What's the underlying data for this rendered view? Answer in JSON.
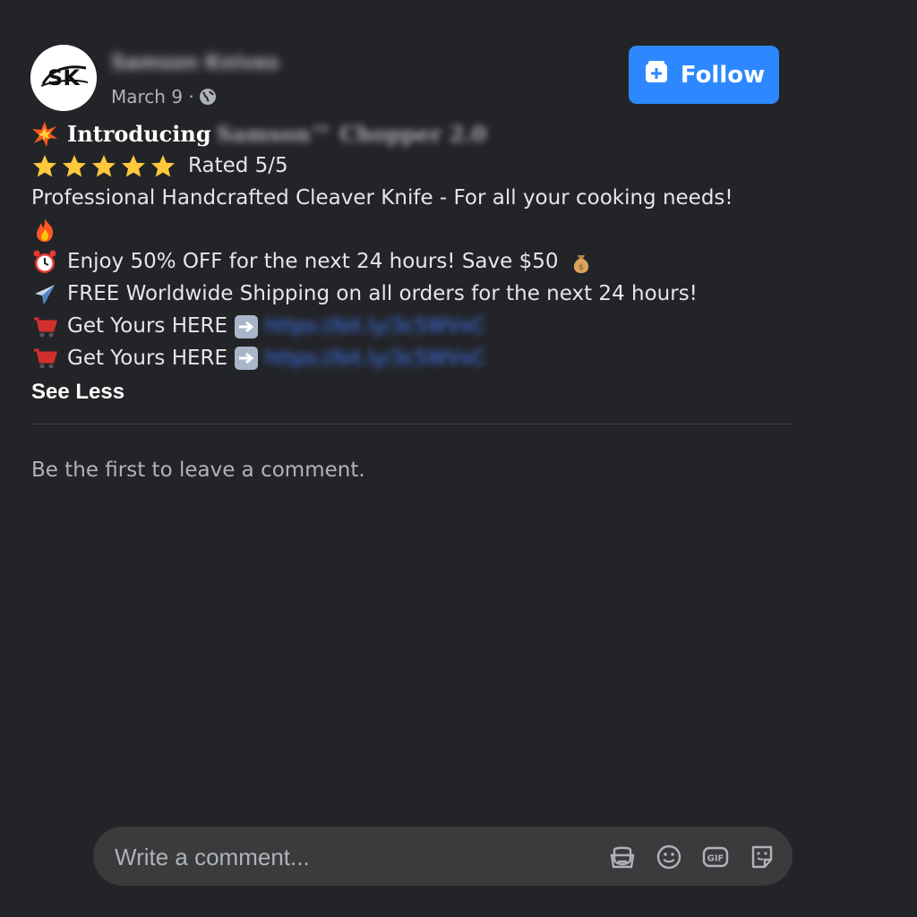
{
  "post": {
    "page_name": "Samson Knives",
    "date": "March 9 ·",
    "follow_label": "Follow",
    "intro_word": "Introducing",
    "product_name": "Samson™ Chopper 2.0",
    "rating_text": "Rated 5/5",
    "description": "Professional Handcrafted Cleaver Knife - For all your cooking needs!",
    "offer_text": "Enjoy 50% OFF for the next 24 hours! Save $50",
    "shipping_text": "FREE Worldwide Shipping on all orders for the next 24 hours!",
    "cta_1": "Get Yours HERE",
    "link_1": "https://bit.ly/3c5WVxC",
    "cta_2": "Get Yours HERE",
    "link_2": "https://bit.ly/3c5WVxC",
    "see_less": "See Less"
  },
  "avatar": {
    "initials": "SK"
  },
  "comments": {
    "empty_text": "Be the first to leave a comment.",
    "input_placeholder": "Write a comment..."
  },
  "icons": {
    "burst": "collision-emoji",
    "stars": "star-emoji",
    "fire": "fire-emoji",
    "clock": "alarm-clock-emoji",
    "money": "money-bag-emoji",
    "plane": "airplane-emoji",
    "cart": "shopping-cart-emoji",
    "arrow": "right-arrow-emoji",
    "toolbar": [
      "avatar-sticker-icon",
      "emoji-icon",
      "gif-icon",
      "sticker-icon"
    ]
  },
  "colors": {
    "background": "#232427",
    "accent": "#2d88ff",
    "link": "#3f7bff"
  }
}
